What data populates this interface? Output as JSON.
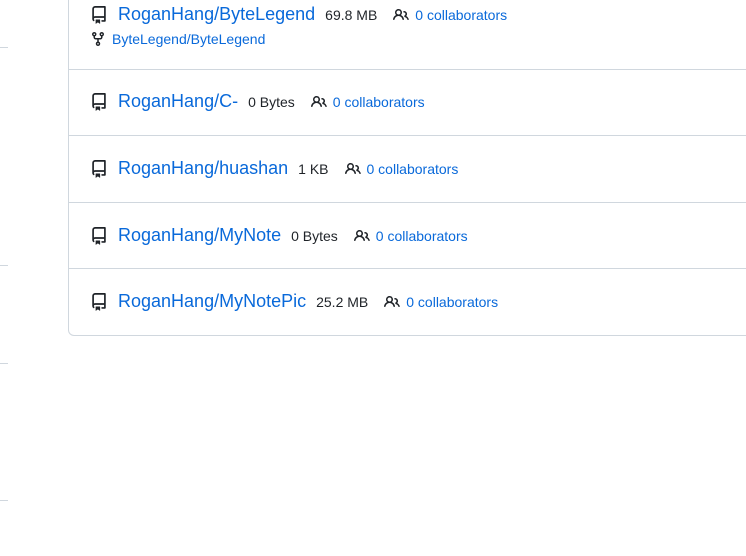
{
  "repos": [
    {
      "name": "RoganHang/ByteLegend",
      "size": "69.8 MB",
      "collaborators": "0 collaborators",
      "fork_of": "ByteLegend/ByteLegend"
    },
    {
      "name": "RoganHang/C-",
      "size": "0 Bytes",
      "collaborators": "0 collaborators"
    },
    {
      "name": "RoganHang/huashan",
      "size": "1 KB",
      "collaborators": "0 collaborators"
    },
    {
      "name": "RoganHang/MyNote",
      "size": "0 Bytes",
      "collaborators": "0 collaborators"
    },
    {
      "name": "RoganHang/MyNotePic",
      "size": "25.2 MB",
      "collaborators": "0 collaborators"
    }
  ],
  "icons": {
    "repo": "repo-icon",
    "people": "people-icon",
    "fork": "fork-icon"
  },
  "colors": {
    "link": "#0969da",
    "border": "#d0d7de",
    "text": "#1f2328"
  }
}
